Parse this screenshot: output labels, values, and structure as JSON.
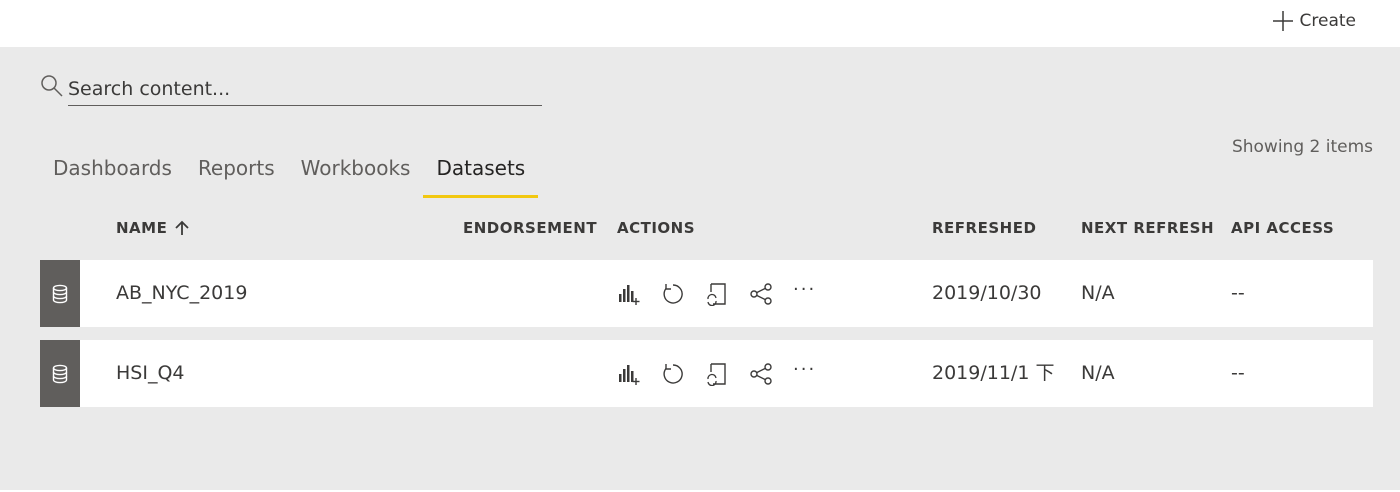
{
  "header": {
    "create_label": "Create"
  },
  "search": {
    "placeholder": "Search content..."
  },
  "showing_text": "Showing 2 items",
  "tabs": [
    {
      "label": "Dashboards",
      "active": false
    },
    {
      "label": "Reports",
      "active": false
    },
    {
      "label": "Workbooks",
      "active": false
    },
    {
      "label": "Datasets",
      "active": true
    }
  ],
  "columns": {
    "name": "NAME",
    "endorsement": "ENDORSEMENT",
    "actions": "ACTIONS",
    "refreshed": "REFRESHED",
    "next_refresh": "NEXT REFRESH",
    "api_access": "API ACCESS"
  },
  "rows": [
    {
      "name": "AB_NYC_2019",
      "endorsement": "",
      "refreshed": "2019/10/30",
      "next_refresh": "N/A",
      "api_access": "--"
    },
    {
      "name": "HSI_Q4",
      "endorsement": "",
      "refreshed": "2019/11/1 下",
      "next_refresh": "N/A",
      "api_access": "--"
    }
  ],
  "icons": {
    "create": "plus-icon",
    "search": "search-icon",
    "sort": "arrow-up-icon",
    "dataset": "database-icon",
    "create_report": "bar-chart-plus-icon",
    "refresh": "refresh-icon",
    "schedule": "scheduled-refresh-icon",
    "lineage": "share-icon",
    "more": "ellipsis-icon"
  },
  "colors": {
    "accent": "#f2c811",
    "row_icon_bg": "#605e5c",
    "page_bg": "#eaeaea"
  }
}
